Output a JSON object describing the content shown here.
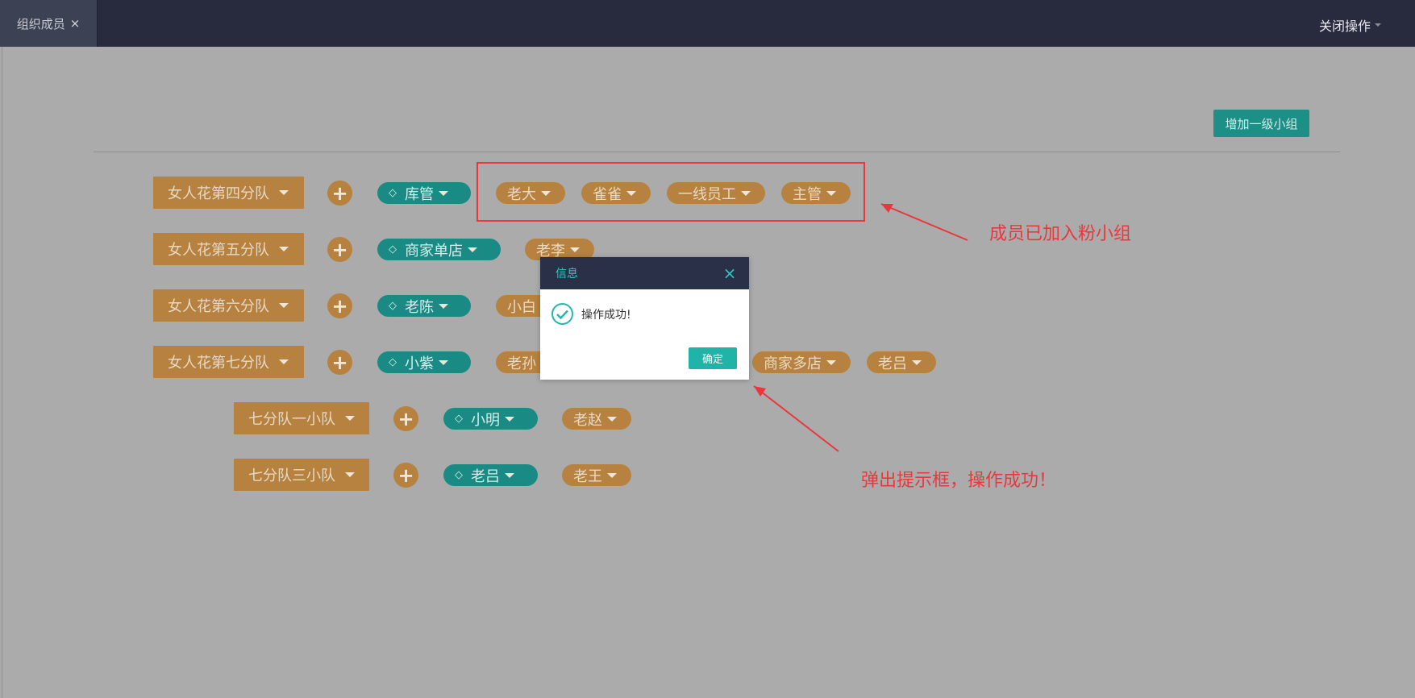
{
  "tab": {
    "label": "组织成员",
    "close": "×"
  },
  "header": {
    "close_ops": "关闭操作"
  },
  "toolbar": {
    "add_group": "增加一级小组"
  },
  "groups": [
    {
      "name": "女人花第四分队",
      "leader": "库管",
      "members": [
        "老大",
        "雀雀",
        "一线员工",
        "主管"
      ]
    },
    {
      "name": "女人花第五分队",
      "leader": "商家单店",
      "members": [
        "老李"
      ]
    },
    {
      "name": "女人花第六分队",
      "leader": "老陈",
      "members": [
        "小白"
      ]
    },
    {
      "name": "女人花第七分队",
      "leader": "小紫",
      "members": [
        "老孙",
        "商家多店",
        "老吕"
      ]
    },
    {
      "name": "七分队一小队",
      "leader": "小明",
      "members": [
        "老赵"
      ]
    },
    {
      "name": "七分队三小队",
      "leader": "老吕",
      "members": [
        "老王"
      ]
    }
  ],
  "annotations": {
    "members_added": "成员已加入粉小组",
    "popup_success": "弹出提示框，操作成功！"
  },
  "dialog": {
    "title": "信息",
    "message": "操作成功!",
    "confirm": "确定"
  },
  "colors": {
    "topbar": "#272b3d",
    "group": "#b7823f",
    "leader": "#1a8b84",
    "accent": "#20b3a7",
    "annotation": "#e8383d"
  },
  "icons": {
    "add": "plus-icon",
    "leader": "diamond-icon",
    "dropdown": "caret-down-icon",
    "success": "check-circle-icon",
    "close": "close-icon"
  }
}
